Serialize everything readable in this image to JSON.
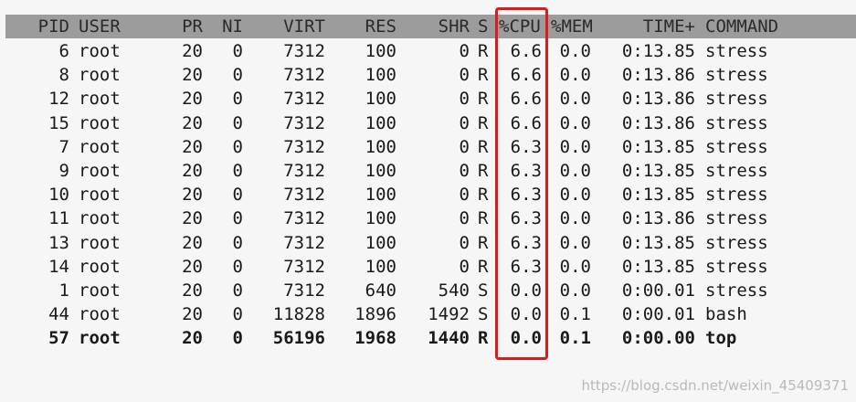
{
  "header": {
    "pid": "PID",
    "user": "USER",
    "pr": "PR",
    "ni": "NI",
    "virt": "VIRT",
    "res": "RES",
    "shr": "SHR",
    "s": "S",
    "cpu": "%CPU",
    "mem": "%MEM",
    "time": "TIME+",
    "command": "COMMAND"
  },
  "rows": [
    {
      "pid": "6",
      "user": "root",
      "pr": "20",
      "ni": "0",
      "virt": "7312",
      "res": "100",
      "shr": "0",
      "s": "R",
      "cpu": "6.6",
      "mem": "0.0",
      "time": "0:13.85",
      "command": "stress"
    },
    {
      "pid": "8",
      "user": "root",
      "pr": "20",
      "ni": "0",
      "virt": "7312",
      "res": "100",
      "shr": "0",
      "s": "R",
      "cpu": "6.6",
      "mem": "0.0",
      "time": "0:13.86",
      "command": "stress"
    },
    {
      "pid": "12",
      "user": "root",
      "pr": "20",
      "ni": "0",
      "virt": "7312",
      "res": "100",
      "shr": "0",
      "s": "R",
      "cpu": "6.6",
      "mem": "0.0",
      "time": "0:13.86",
      "command": "stress"
    },
    {
      "pid": "15",
      "user": "root",
      "pr": "20",
      "ni": "0",
      "virt": "7312",
      "res": "100",
      "shr": "0",
      "s": "R",
      "cpu": "6.6",
      "mem": "0.0",
      "time": "0:13.86",
      "command": "stress"
    },
    {
      "pid": "7",
      "user": "root",
      "pr": "20",
      "ni": "0",
      "virt": "7312",
      "res": "100",
      "shr": "0",
      "s": "R",
      "cpu": "6.3",
      "mem": "0.0",
      "time": "0:13.85",
      "command": "stress"
    },
    {
      "pid": "9",
      "user": "root",
      "pr": "20",
      "ni": "0",
      "virt": "7312",
      "res": "100",
      "shr": "0",
      "s": "R",
      "cpu": "6.3",
      "mem": "0.0",
      "time": "0:13.85",
      "command": "stress"
    },
    {
      "pid": "10",
      "user": "root",
      "pr": "20",
      "ni": "0",
      "virt": "7312",
      "res": "100",
      "shr": "0",
      "s": "R",
      "cpu": "6.3",
      "mem": "0.0",
      "time": "0:13.85",
      "command": "stress"
    },
    {
      "pid": "11",
      "user": "root",
      "pr": "20",
      "ni": "0",
      "virt": "7312",
      "res": "100",
      "shr": "0",
      "s": "R",
      "cpu": "6.3",
      "mem": "0.0",
      "time": "0:13.86",
      "command": "stress"
    },
    {
      "pid": "13",
      "user": "root",
      "pr": "20",
      "ni": "0",
      "virt": "7312",
      "res": "100",
      "shr": "0",
      "s": "R",
      "cpu": "6.3",
      "mem": "0.0",
      "time": "0:13.85",
      "command": "stress"
    },
    {
      "pid": "14",
      "user": "root",
      "pr": "20",
      "ni": "0",
      "virt": "7312",
      "res": "100",
      "shr": "0",
      "s": "R",
      "cpu": "6.3",
      "mem": "0.0",
      "time": "0:13.85",
      "command": "stress"
    },
    {
      "pid": "1",
      "user": "root",
      "pr": "20",
      "ni": "0",
      "virt": "7312",
      "res": "640",
      "shr": "540",
      "s": "S",
      "cpu": "0.0",
      "mem": "0.0",
      "time": "0:00.01",
      "command": "stress"
    },
    {
      "pid": "44",
      "user": "root",
      "pr": "20",
      "ni": "0",
      "virt": "11828",
      "res": "1896",
      "shr": "1492",
      "s": "S",
      "cpu": "0.0",
      "mem": "0.1",
      "time": "0:00.01",
      "command": "bash"
    },
    {
      "pid": "57",
      "user": "root",
      "pr": "20",
      "ni": "0",
      "virt": "56196",
      "res": "1968",
      "shr": "1440",
      "s": "R",
      "cpu": "0.0",
      "mem": "0.1",
      "time": "0:00.00",
      "command": "top",
      "bold": true
    }
  ],
  "annotation": {
    "highlight_column": "%CPU",
    "highlight_color": "#e0191b"
  },
  "watermark": "https://blog.csdn.net/weixin_45409371",
  "colors": {
    "header_bg": "#9c9c9c",
    "background": "#f6f6f6",
    "text": "#1a1a1a"
  }
}
